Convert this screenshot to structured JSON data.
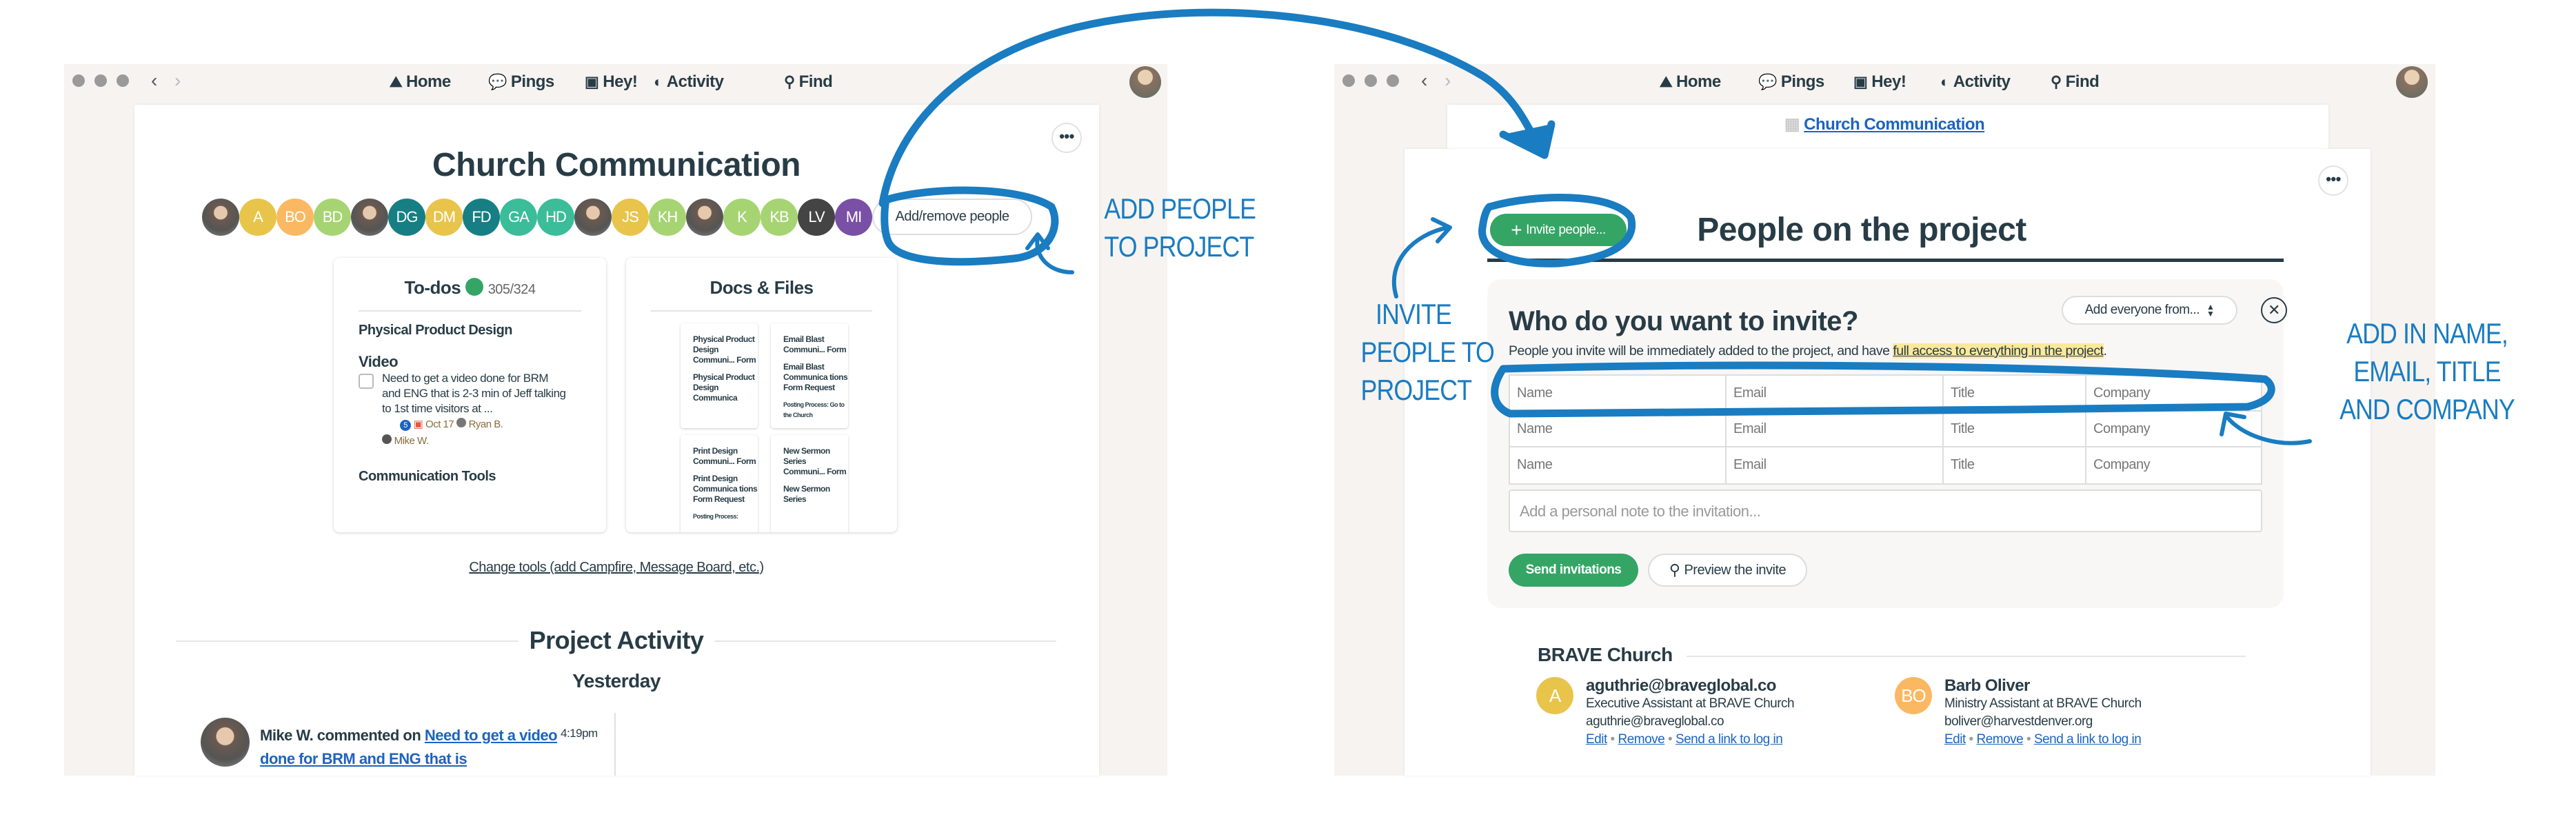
{
  "nav": {
    "home": "Home",
    "pings": "Pings",
    "hey": "Hey!",
    "activity": "Activity",
    "find": "Find"
  },
  "left": {
    "project_title": "Church Communication",
    "people": [
      {
        "initials": "",
        "photo": true
      },
      {
        "initials": "A",
        "color": "#e9c44b"
      },
      {
        "initials": "BO",
        "color": "#fbb862"
      },
      {
        "initials": "BD",
        "color": "#a6d472"
      },
      {
        "initials": "",
        "photo": true
      },
      {
        "initials": "DG",
        "color": "#167f84"
      },
      {
        "initials": "DM",
        "color": "#e9c44b"
      },
      {
        "initials": "FD",
        "color": "#167f84"
      },
      {
        "initials": "GA",
        "color": "#3bbd9a"
      },
      {
        "initials": "HD",
        "color": "#3bbd9a"
      },
      {
        "initials": "",
        "photo": true
      },
      {
        "initials": "JS",
        "color": "#e9c44b"
      },
      {
        "initials": "KH",
        "color": "#a6d472"
      },
      {
        "initials": "",
        "photo": true
      },
      {
        "initials": "K",
        "color": "#a6d472"
      },
      {
        "initials": "KB",
        "color": "#a6d472"
      },
      {
        "initials": "LV",
        "color": "#444444"
      },
      {
        "initials": "MI",
        "color": "#7a4fa6"
      }
    ],
    "add_remove_label": "Add/remove people",
    "todos": {
      "title": "To-dos",
      "progress": "305/324",
      "list1": "Physical Product Design",
      "list2": "Video",
      "item": "Need to get a video done for BRM and ENG that is 2-3 min of Jeff talking to 1st time visitors at ...",
      "comments": "5",
      "due": "Oct 17",
      "assignee1": "Ryan B.",
      "assignee2": "Mike W.",
      "list3": "Communication Tools"
    },
    "docs": {
      "title": "Docs & Files",
      "tiles": [
        {
          "title": "Physical Product Design Communi... Form",
          "body": "Physical Product Design Communica"
        },
        {
          "title": "Email Blast Communi... Form",
          "body": "Email Blast Communica tions Form Request",
          "note": "Posting Process: Go to the Church"
        },
        {
          "title": "Print Design Communi... Form",
          "body": "Print Design Communica tions Form Request",
          "note": "Posting Process:"
        },
        {
          "title": "New Sermon Series Communi... Form",
          "body": "New Sermon Series"
        }
      ]
    },
    "change_tools": "Change tools (add Campfire, Message Board, etc.)",
    "activity_title": "Project Activity",
    "day": "Yesterday",
    "activity": {
      "actor": "Mike W. commented on",
      "link": "Need to get a video done for BRM and ENG that is",
      "time": "4:19pm"
    }
  },
  "right": {
    "breadcrumb": "Church Communication",
    "invite_button": "Invite people...",
    "page_title": "People on the project",
    "panel": {
      "title": "Who do you want to invite?",
      "add_everyone": "Add everyone from...",
      "desc_start": "People you invite will be immediately added to the project, and have ",
      "desc_highlight": "full access to everything in the project",
      "desc_end": ".",
      "placeholders": {
        "name": "Name",
        "email": "Email",
        "title": "Title",
        "company": "Company"
      },
      "note_placeholder": "Add a personal note to the invitation...",
      "send": "Send invitations",
      "preview": "Preview the invite"
    },
    "company": "BRAVE Church",
    "members": [
      {
        "initials": "A",
        "color": "#e9c44b",
        "name": "aguthrie@braveglobal.co",
        "title": "Executive Assistant at BRAVE Church",
        "email": "aguthrie@braveglobal.co"
      },
      {
        "initials": "BO",
        "color": "#fbb862",
        "name": "Barb Oliver",
        "title": "Ministry Assistant at BRAVE Church",
        "email": "boliver@harvestdenver.org"
      }
    ],
    "actions": {
      "edit": "Edit",
      "remove": "Remove",
      "send_link": "Send a link to log in"
    }
  },
  "annotations": {
    "add_people": [
      "ADD PEOPLE",
      "TO PROJECT"
    ],
    "invite_people": [
      "INVITE",
      "PEOPLE TO",
      "PROJECT"
    ],
    "add_fields": [
      "ADD IN NAME,",
      "EMAIL, TITLE",
      "AND COMPANY"
    ]
  },
  "colors": {
    "accent_green": "#34a565",
    "annotation_blue": "#1a7cc1",
    "link_blue": "#1d64bd",
    "text": "#283c46"
  }
}
